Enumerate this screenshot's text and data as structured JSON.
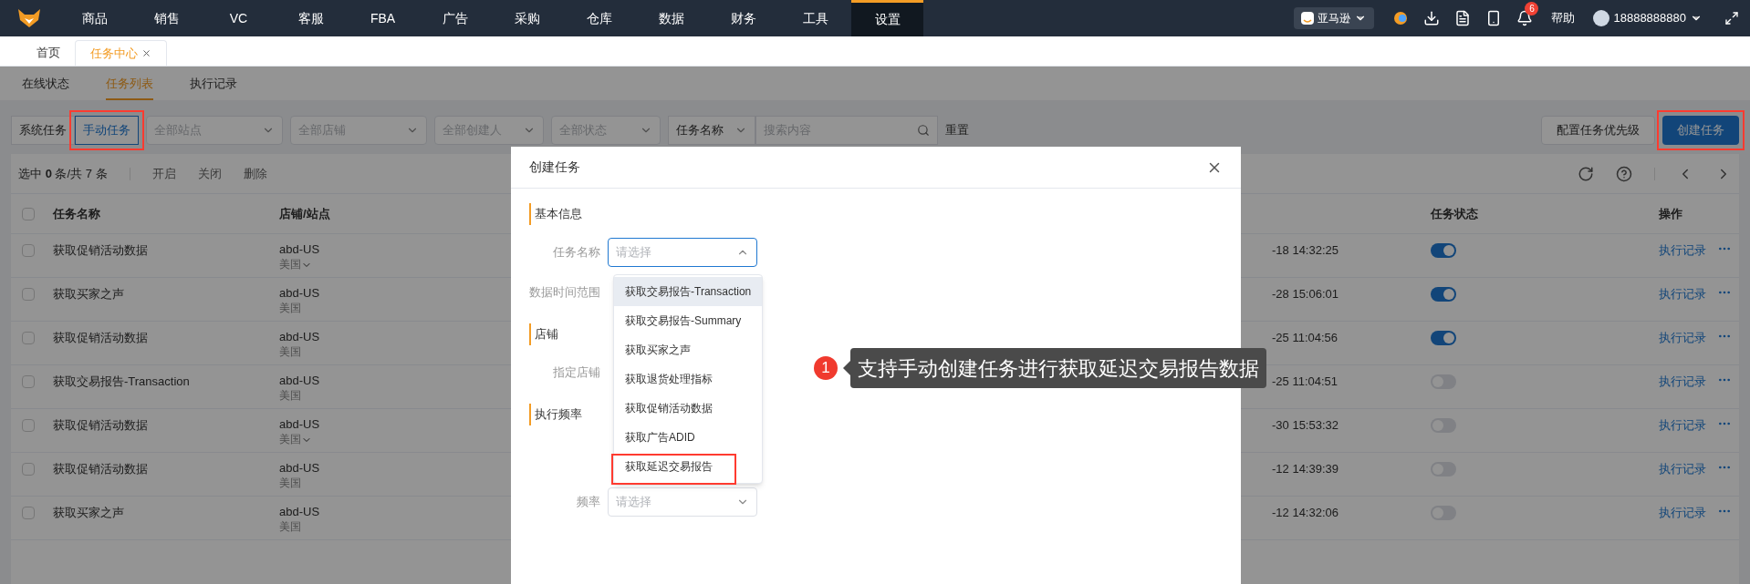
{
  "nav": {
    "items": [
      {
        "label": "商品",
        "selected": false
      },
      {
        "label": "销售",
        "selected": false
      },
      {
        "label": "VC",
        "selected": false
      },
      {
        "label": "客服",
        "selected": false
      },
      {
        "label": "FBA",
        "selected": false
      },
      {
        "label": "广告",
        "selected": false
      },
      {
        "label": "采购",
        "selected": false
      },
      {
        "label": "仓库",
        "selected": false
      },
      {
        "label": "数据",
        "selected": false
      },
      {
        "label": "财务",
        "selected": false
      },
      {
        "label": "工具",
        "selected": false
      },
      {
        "label": "设置",
        "selected": true
      }
    ],
    "marketplace": "亚马逊",
    "notification_count": "6",
    "help": "帮助",
    "user": "18888888880"
  },
  "page_tabs": [
    {
      "label": "首页",
      "selected": false,
      "closable": false
    },
    {
      "label": "任务中心",
      "selected": true,
      "closable": true
    }
  ],
  "sub_tabs": [
    {
      "label": "在线状态",
      "selected": false
    },
    {
      "label": "任务列表",
      "selected": true
    },
    {
      "label": "执行记录",
      "selected": false
    }
  ],
  "filters": {
    "type_tabs": [
      {
        "label": "系统任务",
        "selected": false,
        "annotated": false
      },
      {
        "label": "手动任务",
        "selected": true,
        "annotated": true
      }
    ],
    "selects": [
      {
        "placeholder": "全部站点"
      },
      {
        "placeholder": "全部店铺"
      },
      {
        "placeholder": "全部创建人"
      },
      {
        "placeholder": "全部状态"
      }
    ],
    "search_scope": "任务名称",
    "search_placeholder": "搜索内容",
    "reset": "重置"
  },
  "actions": [
    {
      "label": "配置任务优先级",
      "kind": "secondary",
      "annotated": false
    },
    {
      "label": "创建任务",
      "kind": "primary",
      "annotated": true
    }
  ],
  "toolbar": {
    "selection": "选中 **0** 条/共 7 条",
    "buttons": [
      "开启",
      "关闭",
      "删除"
    ]
  },
  "table": {
    "all_checked": false,
    "columns": [
      {
        "label": "任务名称"
      },
      {
        "label": "店铺/站点"
      },
      {
        "label": "任务状态"
      },
      {
        "label": "操作"
      }
    ],
    "rows": [
      {
        "checked": false,
        "name": "获取促销活动数据",
        "shop": "abd-US",
        "site": "美国",
        "expandable": true,
        "column_3": "-18 14:32:25",
        "on": true,
        "action": "执行记录"
      },
      {
        "checked": false,
        "name": "获取买家之声",
        "shop": "abd-US",
        "site": "美国",
        "expandable": false,
        "column_3": "-28 15:06:01",
        "on": true,
        "action": "执行记录"
      },
      {
        "checked": false,
        "name": "获取促销活动数据",
        "shop": "abd-US",
        "site": "美国",
        "expandable": false,
        "column_3": "-25 11:04:56",
        "on": true,
        "action": "执行记录"
      },
      {
        "checked": false,
        "name": "获取交易报告-Transaction",
        "shop": "abd-US",
        "site": "美国",
        "expandable": false,
        "column_3": "-25 11:04:51",
        "on": false,
        "action": "执行记录"
      },
      {
        "checked": false,
        "name": "获取促销活动数据",
        "shop": "abd-US",
        "site": "美国",
        "expandable": true,
        "column_3": "-30 15:53:32",
        "on": false,
        "action": "执行记录"
      },
      {
        "checked": false,
        "name": "获取促销活动数据",
        "shop": "abd-US",
        "site": "美国",
        "expandable": false,
        "column_3": "-12 14:39:39",
        "on": false,
        "action": "执行记录"
      },
      {
        "checked": false,
        "name": "获取买家之声",
        "shop": "abd-US",
        "site": "美国",
        "expandable": false,
        "column_3": "-12 14:32:06",
        "on": false,
        "action": "执行记录"
      }
    ]
  },
  "modal": {
    "title": "创建任务",
    "sections": [
      {
        "title": "基本信息",
        "fields": [
          {
            "label": "任务名称",
            "kind": "select",
            "placeholder": "请选择",
            "open": true
          },
          {
            "label": "数据时间范围",
            "kind": "empty"
          }
        ]
      },
      {
        "title": "店铺",
        "fields": [
          {
            "label": "指定店铺",
            "kind": "empty"
          }
        ]
      },
      {
        "title": "执行频率",
        "fields": [
          {
            "label": "频率",
            "kind": "select",
            "placeholder": "请选择",
            "open": false
          }
        ]
      }
    ],
    "dropdown": [
      {
        "label": "获取交易报告-Transaction",
        "hovered": true,
        "annotated": false
      },
      {
        "label": "获取交易报告-Summary",
        "hovered": false,
        "annotated": false
      },
      {
        "label": "获取买家之声",
        "hovered": false,
        "annotated": false
      },
      {
        "label": "获取退货处理指标",
        "hovered": false,
        "annotated": false
      },
      {
        "label": "获取促销活动数据",
        "hovered": false,
        "annotated": false
      },
      {
        "label": "获取广告ADID",
        "hovered": false,
        "annotated": false
      },
      {
        "label": "获取延迟交易报告",
        "hovered": false,
        "annotated": true
      }
    ],
    "callout": {
      "number": "1",
      "text": "支持手动创建任务进行获取延迟交易报告数据"
    }
  }
}
